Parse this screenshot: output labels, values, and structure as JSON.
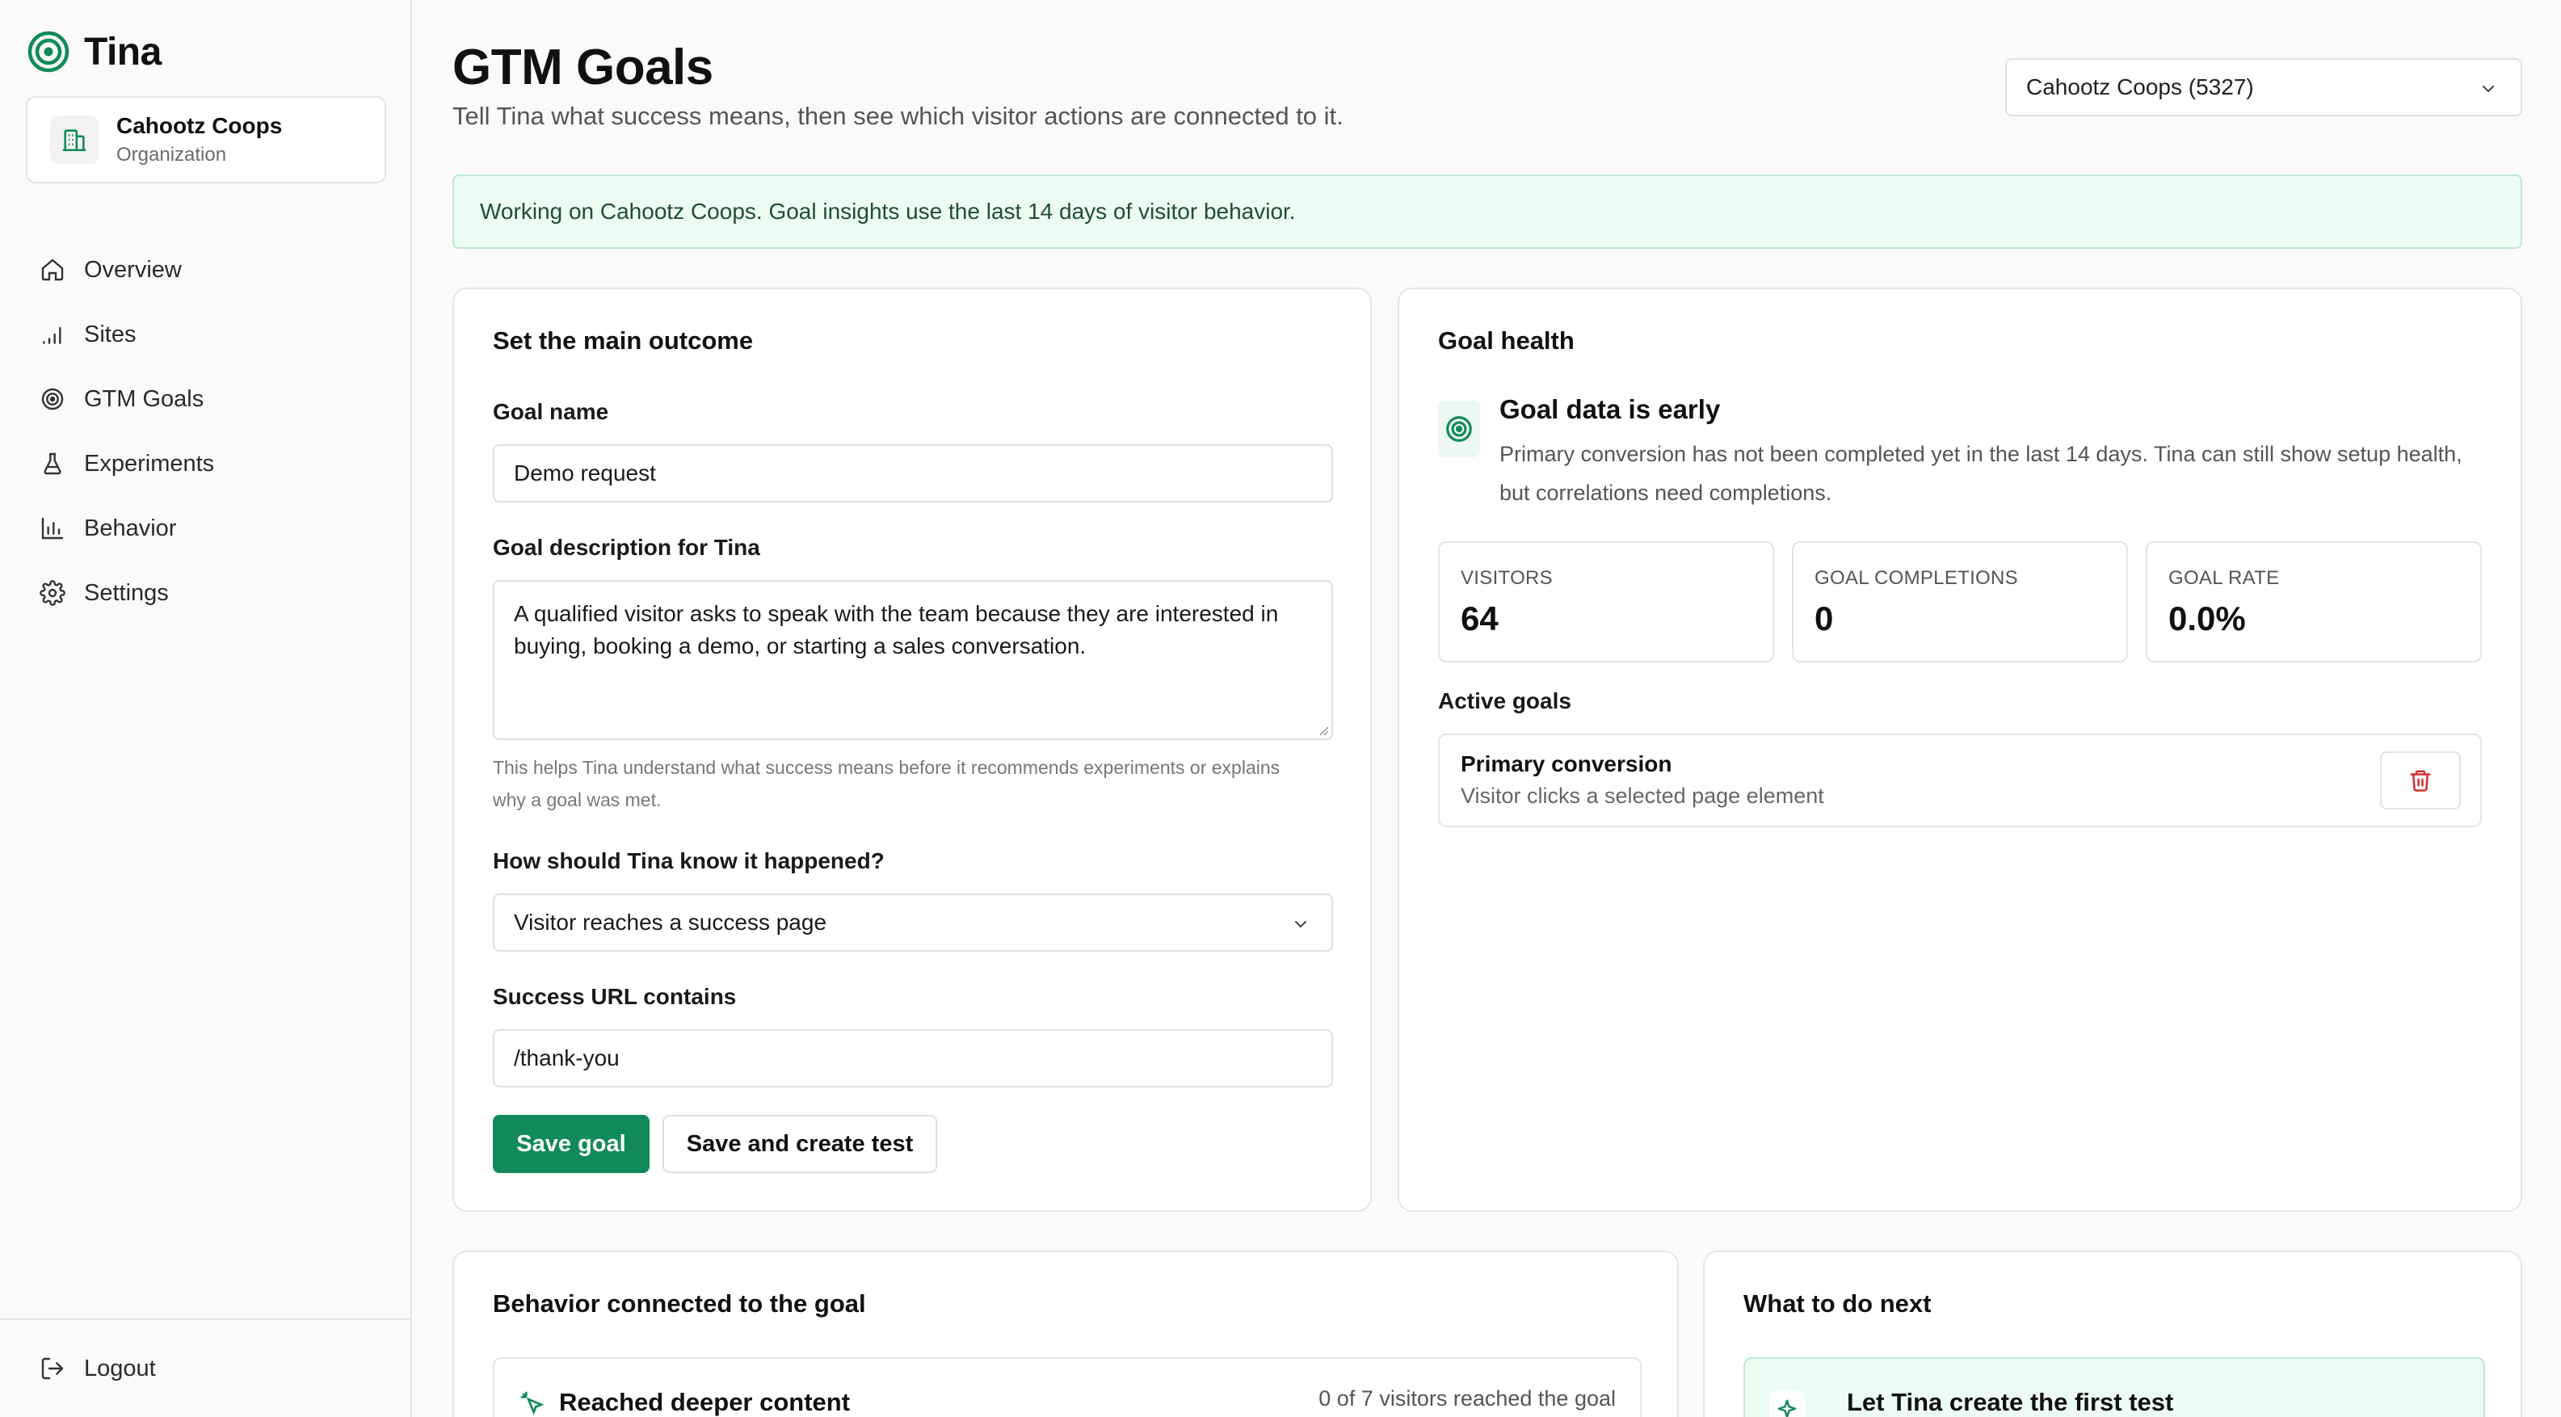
{
  "app": {
    "name": "Tina"
  },
  "org": {
    "name": "Cahootz Coops",
    "type": "Organization"
  },
  "nav": {
    "items": [
      {
        "label": "Overview",
        "icon": "home-icon"
      },
      {
        "label": "Sites",
        "icon": "signal-bars-icon"
      },
      {
        "label": "GTM Goals",
        "icon": "target-icon"
      },
      {
        "label": "Experiments",
        "icon": "flask-icon"
      },
      {
        "label": "Behavior",
        "icon": "bar-chart-icon"
      },
      {
        "label": "Settings",
        "icon": "gear-icon"
      }
    ],
    "logout": "Logout"
  },
  "header": {
    "title": "GTM Goals",
    "subtitle": "Tell Tina what success means, then see which visitor actions are connected to it.",
    "org_select": "Cahootz Coops (5327)"
  },
  "banner": "Working on Cahootz Coops. Goal insights use the last 14 days of visitor behavior.",
  "outcome": {
    "title": "Set the main outcome",
    "goal_name_label": "Goal name",
    "goal_name_value": "Demo request",
    "desc_label": "Goal description for Tina",
    "desc_value": "A qualified visitor asks to speak with the team because they are interested in buying, booking a demo, or starting a sales conversation.",
    "help_text": "This helps Tina understand what success means before it recommends experiments or explains why a goal was met.",
    "method_label": "How should Tina know it happened?",
    "method_value": "Visitor reaches a success page",
    "url_label": "Success URL contains",
    "url_value": "/thank-you",
    "save_label": "Save goal",
    "save_test_label": "Save and create test"
  },
  "health": {
    "title": "Goal health",
    "status_title": "Goal data is early",
    "status_text": "Primary conversion has not been completed yet in the last 14 days. Tina can still show setup health, but correlations need completions.",
    "stats": [
      {
        "label": "VISITORS",
        "value": "64"
      },
      {
        "label": "GOAL COMPLETIONS",
        "value": "0"
      },
      {
        "label": "GOAL RATE",
        "value": "0.0%"
      }
    ],
    "active_label": "Active goals",
    "goal": {
      "name": "Primary conversion",
      "desc": "Visitor clicks a selected page element"
    }
  },
  "behavior": {
    "title": "Behavior connected to the goal",
    "item_title": "Reached deeper content",
    "item_meta": "0 of 7 visitors reached the goal"
  },
  "next": {
    "title": "What to do next",
    "item_title": "Let Tina create the first test"
  },
  "colors": {
    "accent": "#108a5a",
    "banner_bg": "#ecfbf3",
    "danger": "#d32f2f"
  }
}
